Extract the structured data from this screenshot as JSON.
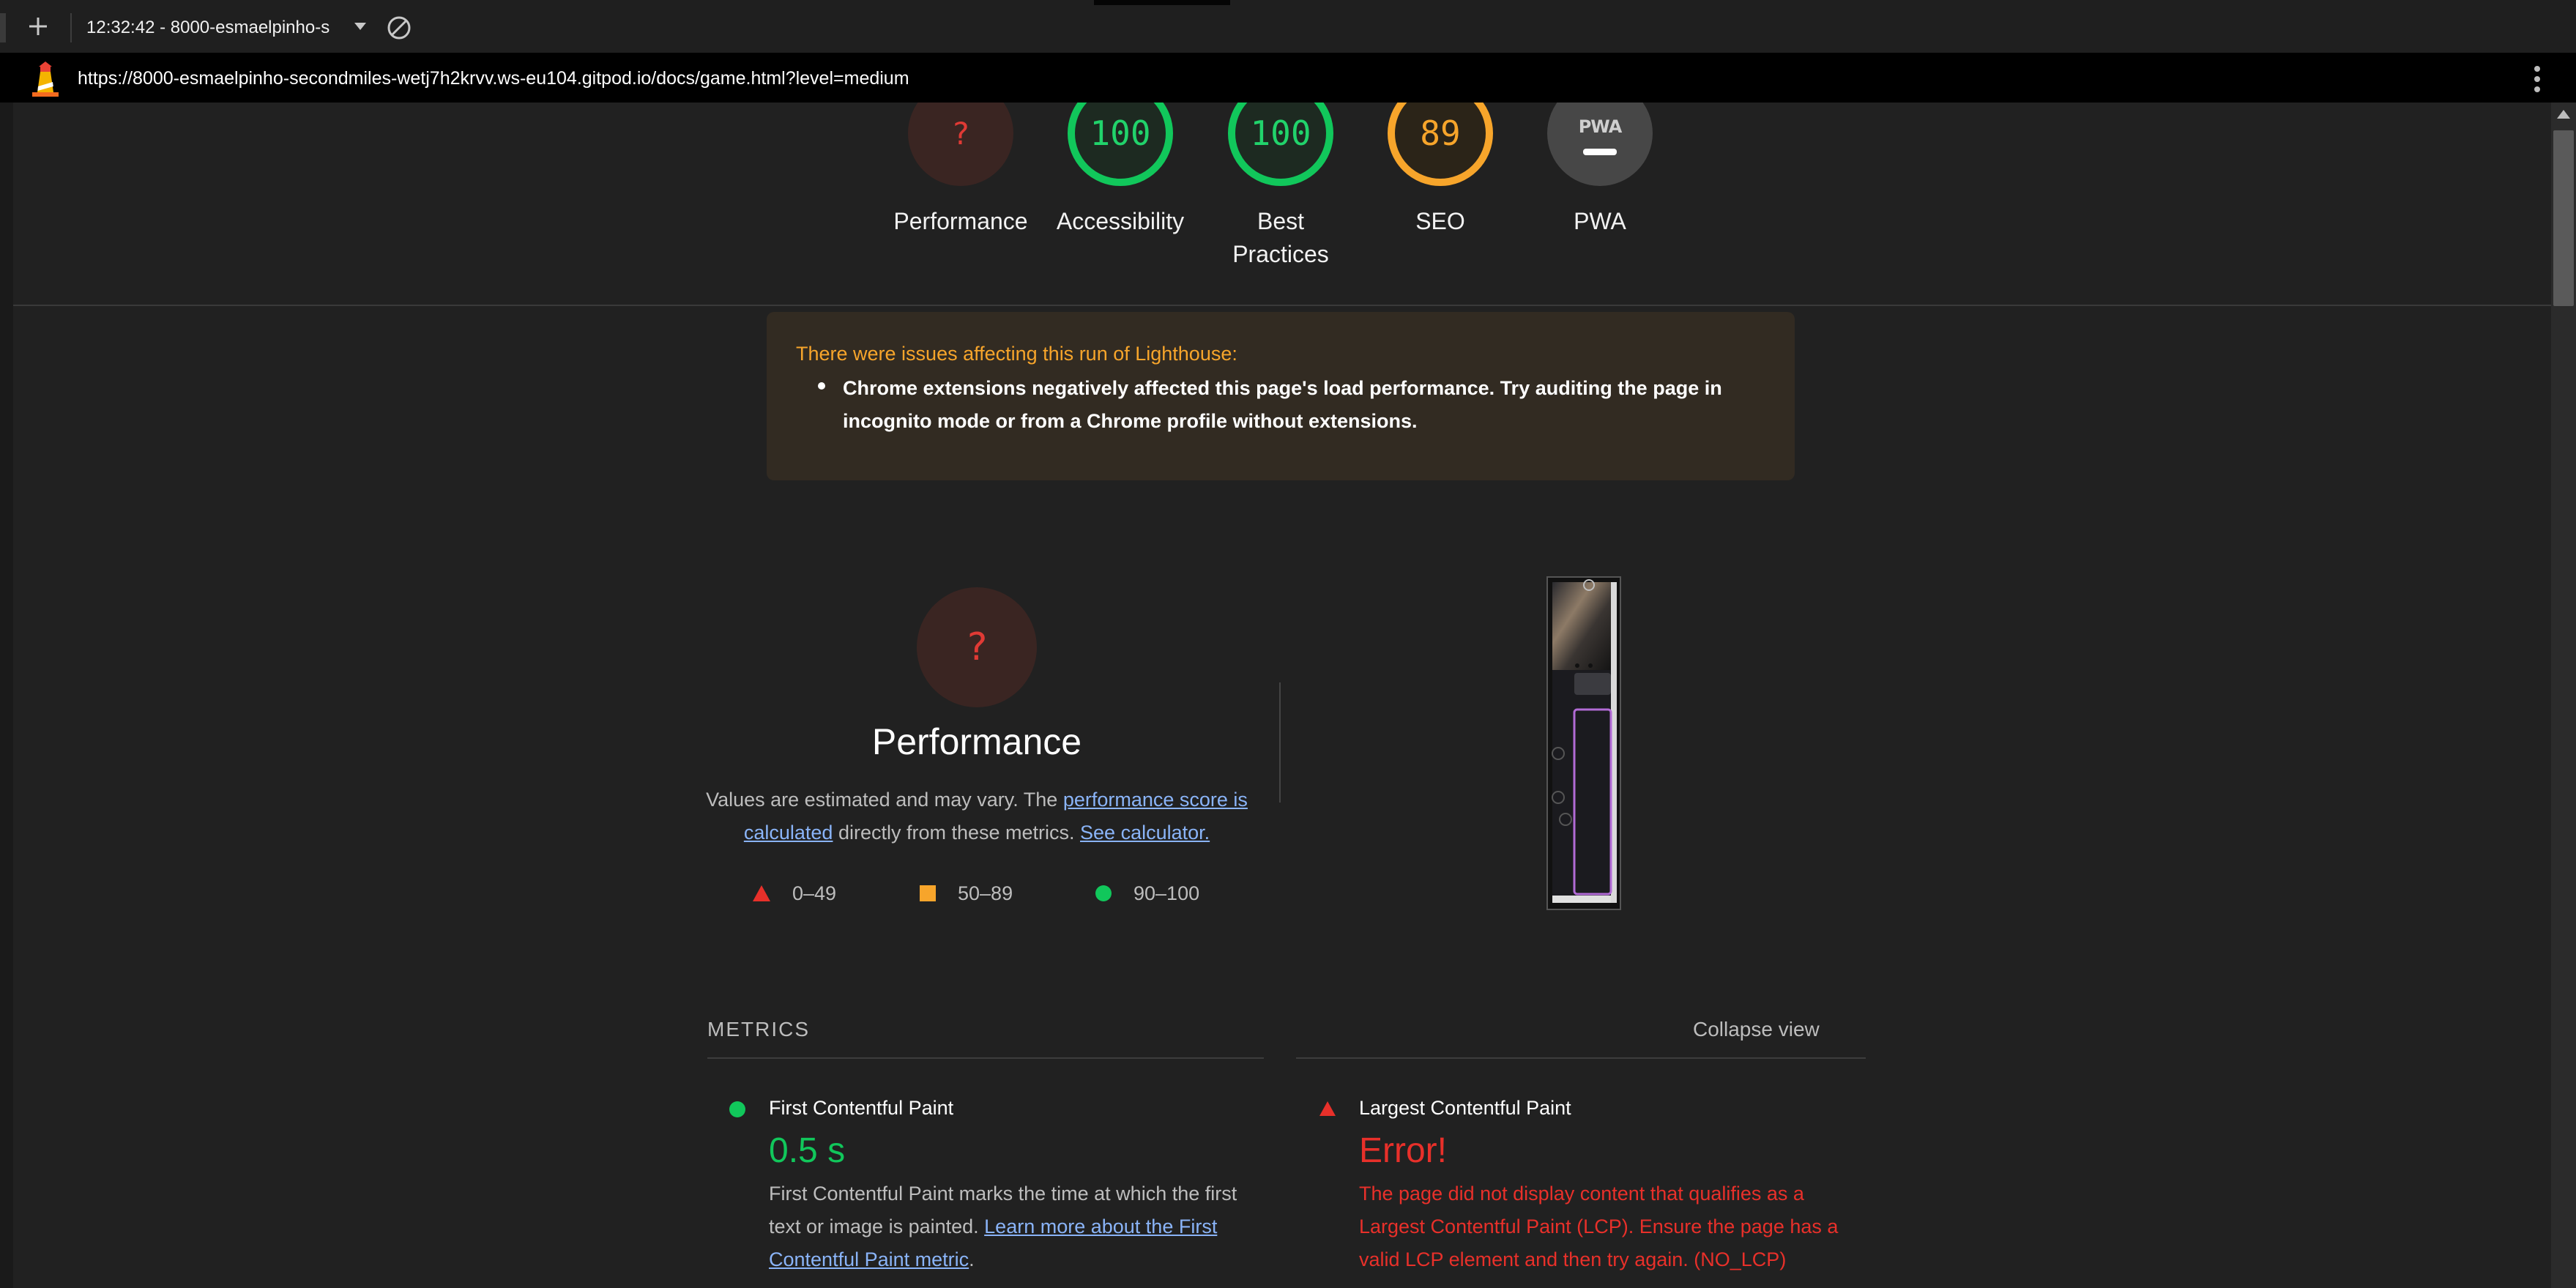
{
  "browser": {
    "tab_title": "12:32:42 - 8000-esmaelpinho-s",
    "url": "https://8000-esmaelpinho-secondmiles-wetj7h2krvv.ws-eu104.gitpod.io/docs/game.html?level=medium"
  },
  "gauges": [
    {
      "label": "Performance",
      "score": "?",
      "status": "error"
    },
    {
      "label": "Accessibility",
      "score": "100",
      "status": "pass"
    },
    {
      "label_line1": "Best",
      "label_line2": "Practices",
      "score": "100",
      "status": "pass"
    },
    {
      "label": "SEO",
      "score": "89",
      "status": "average"
    },
    {
      "label": "PWA",
      "badge": "PWA",
      "status": "not-applicable"
    }
  ],
  "warning": {
    "title": "There were issues affecting this run of Lighthouse:",
    "item": "Chrome extensions negatively affected this page's load performance. Try auditing the page in incognito mode or from a Chrome profile without extensions."
  },
  "performance": {
    "score": "?",
    "title": "Performance",
    "desc_before": "Values are estimated and may vary. The ",
    "link1": "performance score is calculated",
    "desc_middle": " directly from these metrics. ",
    "link2": "See calculator."
  },
  "legend": [
    {
      "range": "0–49",
      "shape": "triangle",
      "color": "#e8302a"
    },
    {
      "range": "50–89",
      "shape": "square",
      "color": "#f7a52b"
    },
    {
      "range": "90–100",
      "shape": "circle",
      "color": "#11c75b"
    }
  ],
  "metrics": {
    "header": "METRICS",
    "toggle": "Collapse view",
    "items": [
      {
        "name": "First Contentful Paint",
        "value": "0.5 s",
        "desc_before": "First Contentful Paint marks the time at which the first text or image is painted. ",
        "link": "Learn more about the First Contentful Paint metric",
        "desc_after": "."
      },
      {
        "name": "Largest Contentful Paint",
        "value": "Error!",
        "desc": "The page did not display content that qualifies as a Largest Contentful Paint (LCP). Ensure the page has a valid LCP element and then try again. (NO_LCP)"
      }
    ]
  },
  "colors": {
    "pass": "#11c75b",
    "average": "#f7a52b",
    "fail": "#e8302a",
    "link": "#8ab4f8"
  }
}
